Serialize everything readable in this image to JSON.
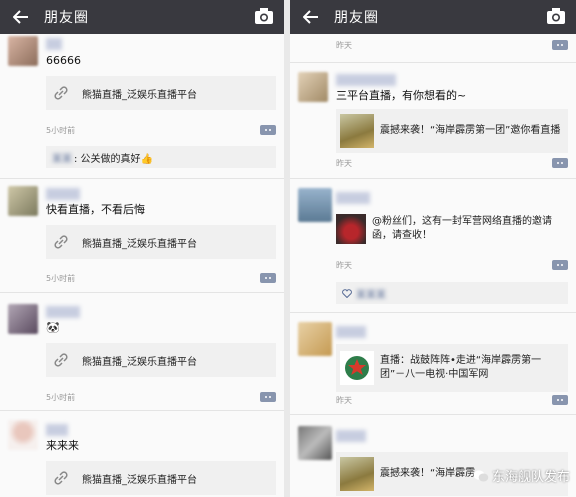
{
  "left": {
    "header": {
      "title": "朋友圈"
    },
    "posts": [
      {
        "text": "66666",
        "link": "熊猫直播_泛娱乐直播平台",
        "time": "5小时前",
        "comment_user": "某某",
        "comment_text": ": 公关做的真好👍"
      },
      {
        "text": "快看直播，不看后悔",
        "link": "熊猫直播_泛娱乐直播平台",
        "time": "5小时前"
      },
      {
        "text": "🐼",
        "link": "熊猫直播_泛娱乐直播平台",
        "time": "5小时前"
      },
      {
        "text": "来来来",
        "link": "熊猫直播_泛娱乐直播平台"
      }
    ]
  },
  "right": {
    "header": {
      "title": "朋友圈"
    },
    "top_time": "昨天",
    "posts": [
      {
        "text": "三平台直播，有你想看的~",
        "share": "震撼来袭！“海岸霹雳第一团”邀你看直播",
        "time": "昨天"
      },
      {
        "text": "@粉丝们，这有一封军营网络直播的邀请函，请查收！",
        "time": "昨天",
        "like_user": "某某某"
      },
      {
        "share": "直播：战鼓阵阵•走进“海岸霹雳第一团”－八一电视·中国军网",
        "time": "昨天"
      },
      {
        "share": "震撼来袭！“海岸霹雳"
      }
    ],
    "watermark": "东海舰队发布"
  },
  "colors": {
    "topbar": "#39393f",
    "name_blue": "#576b95",
    "card_bg": "#f0f0f0"
  },
  "icons": [
    "back-arrow-icon",
    "camera-icon",
    "link-chain-icon",
    "more-dots-icon",
    "heart-icon",
    "wechat-icon"
  ]
}
